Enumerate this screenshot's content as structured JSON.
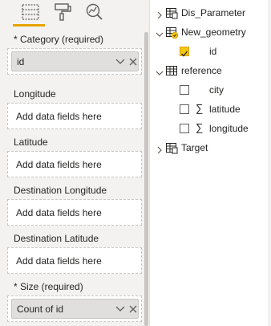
{
  "wells": {
    "category": {
      "label": "* Category (required)",
      "value": "id"
    },
    "longitude": {
      "label": "Longitude",
      "placeholder": "Add data fields here"
    },
    "latitude": {
      "label": "Latitude",
      "placeholder": "Add data fields here"
    },
    "dest_longitude": {
      "label": "Destination Longitude",
      "placeholder": "Add data fields here"
    },
    "dest_latitude": {
      "label": "Destination Latitude",
      "placeholder": "Add data fields here"
    },
    "size": {
      "label": "* Size (required)",
      "value": "Count of id"
    }
  },
  "fields": {
    "dis_parameter": "Dis_Parameter",
    "new_geometry": "New_geometry",
    "new_geometry_id": "id",
    "reference": "reference",
    "city": "city",
    "latitude": "latitude",
    "longitude": "longitude",
    "target": "Target",
    "sigma": "∑"
  },
  "colors": {
    "accent": "#e8a400",
    "checkbox_checked": "#f2c811"
  },
  "icons": [
    "fields-icon",
    "format-paint-icon",
    "analytics-icon",
    "chevron-down-icon",
    "close-icon",
    "table-icon",
    "sigma-icon",
    "checkbox-icon"
  ]
}
